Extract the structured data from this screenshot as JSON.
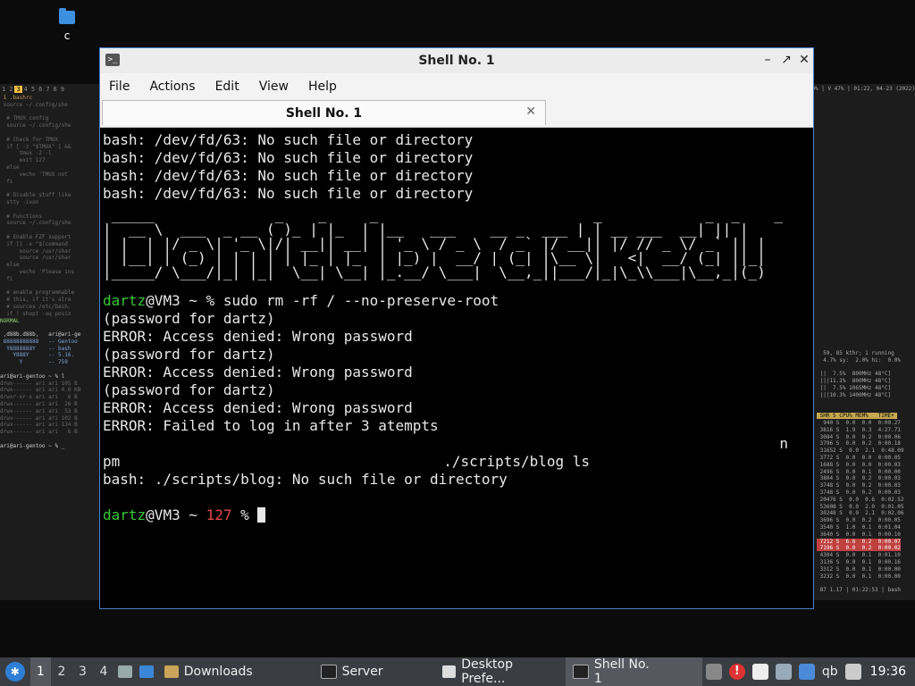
{
  "desktop": {
    "icon_label": "c"
  },
  "bg": {
    "tabs": [
      "1",
      "2",
      "3",
      "4",
      "5",
      "6",
      "7",
      "8",
      "9"
    ],
    "active_tab": "3",
    "status_right": "90% | V 47% | 01:22, 04-23 (2022)"
  },
  "window": {
    "title": "Shell No. 1",
    "menu": [
      "File",
      "Actions",
      "Edit",
      "View",
      "Help"
    ],
    "tab_label": "Shell No. 1"
  },
  "terminal": {
    "errors": [
      "bash: /dev/fd/63: No such file or directory",
      "bash: /dev/fd/63: No such file or directory",
      "bash: /dev/fd/63: No such file or directory",
      "bash: /dev/fd/63: No such file or directory"
    ],
    "ascii_art": " _____              _    _     _                         _            _  _    _ \n|  __ \\  ___  _ __ ( )_ | |_  | |__   ___    __ _  ___ | | __ ___  __| || |\n| |  | |/ _ \\| '_ \\|/| __|| __| | '_ \\ / _ \\  / _` |/ __|| |/ // _ \\/ _` || |\n| |__| | (_) | | | | | |_ | |_  | |_) |  __/ | (_| |\\__ \\|   <|  __/ (_| ||_|\n|_____/ \\___/|_| |_|  \\__| \\__| |_.__/ \\___|  \\__,_||___/|_|\\_\\\\___|\\__,_|(_)",
    "prompt_user": "dartz",
    "prompt_host": "@VM3 ~ % ",
    "command": "sudo rm -rf / --no-preserve-root",
    "lines": [
      "(password for dartz)",
      "ERROR: Access denied: Wrong password",
      "(password for dartz)",
      "ERROR: Access denied: Wrong password",
      "(password for dartz)",
      "ERROR: Access denied: Wrong password",
      "ERROR: Failed to log in after 3 atempts"
    ],
    "stray_n": "n",
    "pm_line_a": "pm",
    "pm_line_b": "./scripts/blog ls",
    "blog_error": "bash: ./scripts/blog: No such file or directory",
    "prompt2_host": "@VM3 ~ ",
    "prompt2_code": "127",
    "prompt2_suffix": " % "
  },
  "taskbar": {
    "workspaces": [
      "1",
      "2",
      "3",
      "4"
    ],
    "active_workspace": "1",
    "items": [
      {
        "label": "Downloads",
        "icon": "folder-icon"
      },
      {
        "label": "Server",
        "icon": "terminal-icon"
      },
      {
        "label": "Desktop Prefe...",
        "icon": "window-icon"
      },
      {
        "label": "Shell No. 1",
        "icon": "terminal-icon"
      }
    ],
    "tray_text": "qb",
    "clock": "19:36"
  },
  "colors": {
    "prompt_green": "#39c739",
    "exit_red": "#e04848",
    "window_border": "#4a7fc8"
  }
}
